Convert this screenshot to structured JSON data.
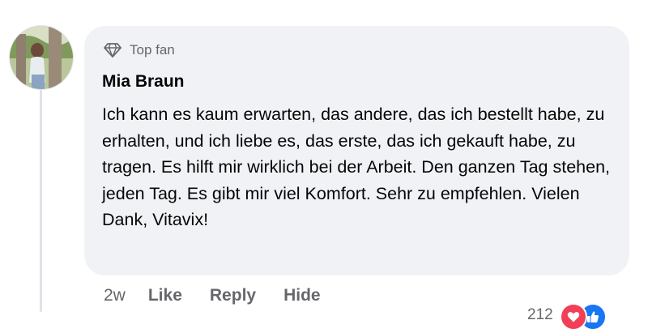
{
  "comment": {
    "badge_label": "Top fan",
    "author": "Mia Braun",
    "text": "Ich kann es kaum erwarten, das andere, das ich bestellt habe, zu erhalten, und ich liebe es, das erste, das ich gekauft habe, zu tragen. Es hilft mir wirklich bei der Arbeit. Den ganzen Tag stehen, jeden Tag. Es gibt mir viel Komfort. Sehr zu empfehlen. Vielen Dank, Vitavix!"
  },
  "actions": {
    "time": "2w",
    "like_label": "Like",
    "reply_label": "Reply",
    "hide_label": "Hide"
  },
  "reactions": {
    "count": "212",
    "icons": [
      "heart-icon",
      "thumbs-up-icon"
    ],
    "colors": {
      "love": "#f33e58",
      "like": "#1877f2"
    }
  },
  "colors": {
    "bubble_bg": "#f0f2f5",
    "secondary_text": "#65676b",
    "primary_text": "#050505"
  }
}
